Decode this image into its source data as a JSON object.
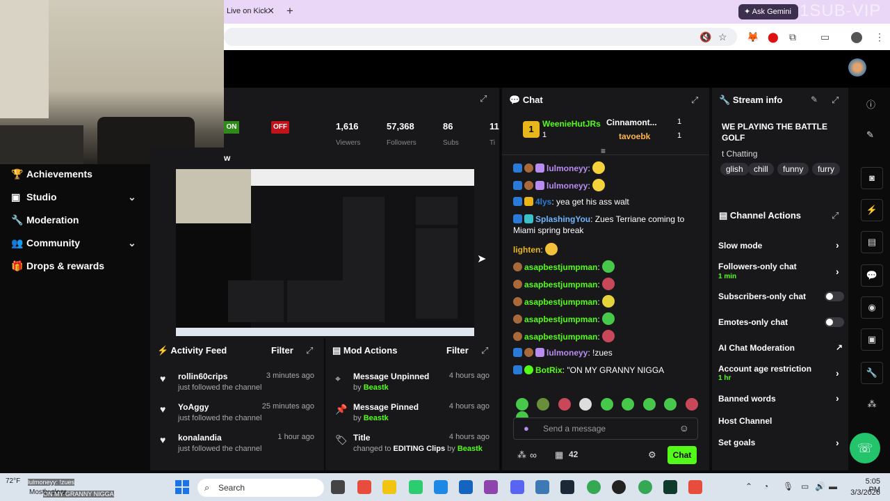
{
  "browser": {
    "tab_title": "Live on Kick",
    "tab_close": "✕",
    "new_tab": "+",
    "gemini_label": "Ask Gemini",
    "watermark": "1SUB-VIP"
  },
  "sidebar": {
    "items": [
      {
        "label": "Achievements",
        "icon": "trophy-icon"
      },
      {
        "label": "Studio",
        "icon": "studio-icon",
        "has_chevron": true
      },
      {
        "label": "Moderation",
        "icon": "wrench-icon"
      },
      {
        "label": "Community",
        "icon": "people-icon",
        "has_chevron": true
      },
      {
        "label": "Drops & rewards",
        "icon": "gift-icon"
      }
    ]
  },
  "stats": {
    "on_label": "ON",
    "off_label": "OFF",
    "values": [
      "1,616",
      "57,368",
      "86",
      "11"
    ],
    "labels": [
      "Viewers",
      "Followers",
      "Subs",
      "Ti"
    ],
    "preview_label": "w"
  },
  "activity_feed": {
    "title": "Activity Feed",
    "filter": "Filter",
    "items": [
      {
        "user": "rollin60crips",
        "action": "just followed the channel",
        "time": "3 minutes ago"
      },
      {
        "user": "YoAggy",
        "action": "just followed the channel",
        "time": "25 minutes ago"
      },
      {
        "user": "konalandia",
        "action": "just followed the channel",
        "time": "1 hour ago"
      }
    ]
  },
  "mod_actions": {
    "title": "Mod Actions",
    "filter": "Filter",
    "items": [
      {
        "title": "Message Unpinned",
        "by_prefix": "by",
        "by": "Beastk",
        "time": "4 hours ago",
        "icon": "unpin-icon"
      },
      {
        "title": "Message Pinned",
        "by_prefix": "by",
        "by": "Beastk",
        "time": "4 hours ago",
        "icon": "pin-icon"
      },
      {
        "title": "Title",
        "detail_prefix": "changed to",
        "detail": "EDITING Clips",
        "by_prefix": "by",
        "by": "Beastk",
        "time": "4 hours ago",
        "icon": "title-icon"
      }
    ]
  },
  "chat": {
    "title": "Chat",
    "leaderboard": [
      {
        "rank": "1",
        "name": "WeenieHutJRs",
        "count": "1"
      },
      {
        "name": "Cinnamont...",
        "count": "1"
      },
      {
        "name": "tavoebk",
        "count": "1"
      }
    ],
    "messages": [
      {
        "user": "lulmoneyy",
        "text": "",
        "color": "#b98cf2"
      },
      {
        "user": "lulmoneyy",
        "text": "",
        "color": "#b98cf2"
      },
      {
        "user": "4lys",
        "text": "yea get his ass walt",
        "color": "#2a7bd8"
      },
      {
        "user": "SplashingYou",
        "text": "Zues Terriane coming to Miami spring break",
        "color": "#6fb7ff"
      },
      {
        "user": "lighten",
        "text": "",
        "color": "#e8b51a"
      },
      {
        "user": "asapbestjumpman",
        "text": "",
        "color": "#53fc18"
      },
      {
        "user": "asapbestjumpman",
        "text": "",
        "color": "#53fc18"
      },
      {
        "user": "asapbestjumpman",
        "text": "",
        "color": "#53fc18"
      },
      {
        "user": "asapbestjumpman",
        "text": "",
        "color": "#53fc18"
      },
      {
        "user": "asapbestjumpman",
        "text": "",
        "color": "#53fc18"
      },
      {
        "user": "lulmoneyy",
        "text": "!zues",
        "color": "#b98cf2"
      },
      {
        "user": "BotRix",
        "text": "\"ON MY GRANNY NIGGA",
        "color": "#53fc18"
      }
    ],
    "input_placeholder": "Send a message",
    "viewer_count": "42",
    "send_label": "Chat",
    "infinity": "∞"
  },
  "stream_info": {
    "title": "Stream info",
    "stream_title": "WE PLAYING THE BATTLE GOLF",
    "category": "t Chatting",
    "tags": [
      "glish",
      "chill",
      "funny",
      "furry"
    ]
  },
  "channel_actions": {
    "title": "Channel Actions",
    "rows": [
      {
        "label": "Slow mode"
      },
      {
        "label": "Followers-only chat",
        "sub": "1 min"
      },
      {
        "label": "Subscribers-only chat"
      },
      {
        "label": "Emotes-only chat"
      },
      {
        "label": "AI Chat Moderation"
      },
      {
        "label": "Account age restriction",
        "sub": "1 hr"
      },
      {
        "label": "Banned words"
      },
      {
        "label": "Host Channel"
      },
      {
        "label": "Set goals"
      }
    ]
  },
  "taskbar": {
    "search_placeholder": "Search",
    "time": "5:05 PM",
    "date": "3/3/2026",
    "weather_line1": "72°F",
    "weather_line2": "Mostly clear",
    "notif_text": "ON MY GRANNY NIGGA",
    "notif_user": "lulmoneyy: !zues"
  },
  "colors": {
    "accent": "#53fc18",
    "panel_bg": "#18181b",
    "page_bg": "#0b0b0c",
    "off_red": "#c2131b"
  }
}
